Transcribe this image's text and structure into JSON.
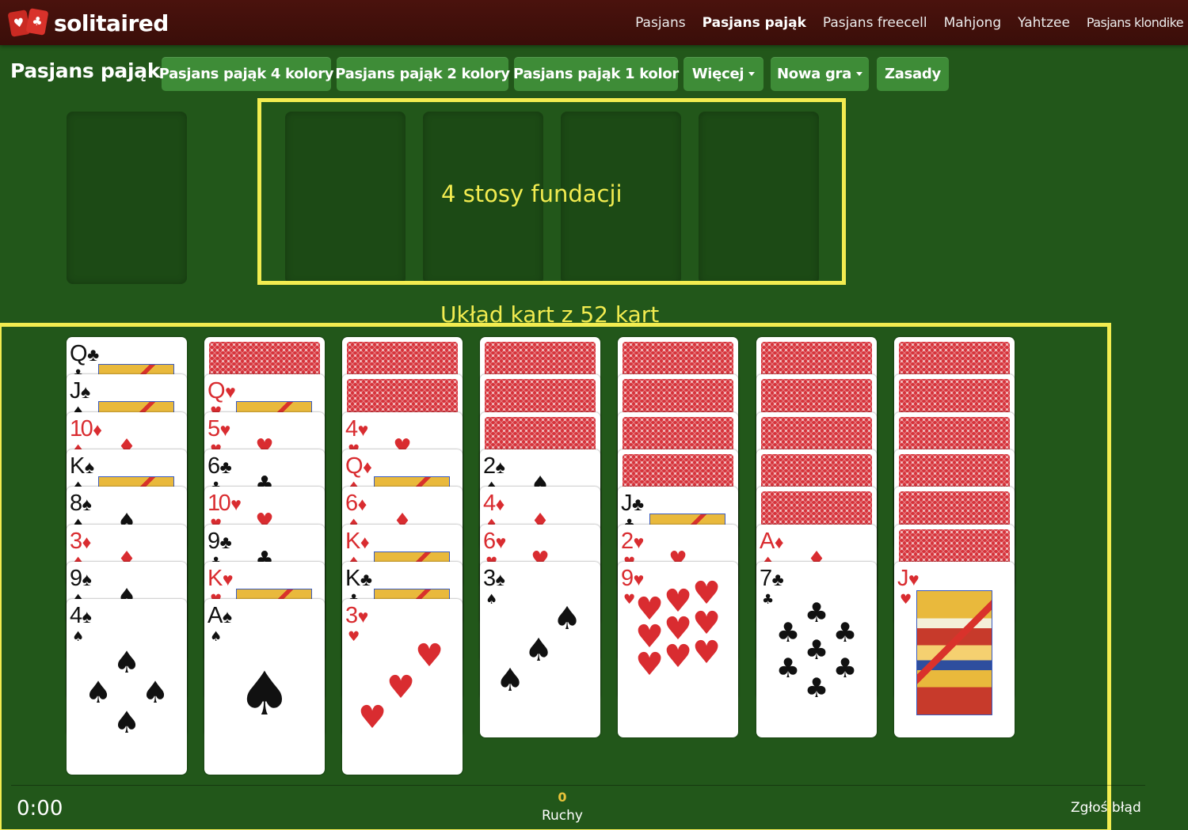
{
  "nav": {
    "logo_text": "solitaired",
    "links": [
      "Pasjans",
      "Pasjans pająk",
      "Pasjans freecell",
      "Mahjong",
      "Yahtzee",
      "Pasjans klondike"
    ],
    "active": "Pasjans pająk"
  },
  "toolbar": {
    "title": "Pasjans pająk",
    "buttons": [
      "Pasjans pająk 4 kolory",
      "Pasjans pająk 2 kolory",
      "Pasjans pająk 1 kolor",
      "Więcej",
      "Nowa gra",
      "Zasady"
    ]
  },
  "annotations": {
    "foundations": "4 stosy fundacji",
    "tableau": "Układ kart z 52 kart"
  },
  "colors": {
    "felt": "#22571a",
    "button": "#3e8c37",
    "highlight": "#f2ec50",
    "red_suit": "#d92c30",
    "card_back": "#d6323a"
  },
  "tableau": [
    {
      "facedown": 0,
      "cards": [
        [
          "Q",
          "♣"
        ],
        [
          "J",
          "♠"
        ],
        [
          "10",
          "♦"
        ],
        [
          "K",
          "♠"
        ],
        [
          "8",
          "♠"
        ],
        [
          "3",
          "♦"
        ],
        [
          "9",
          "♠"
        ],
        [
          "4",
          "♠"
        ]
      ]
    },
    {
      "facedown": 1,
      "cards": [
        [
          "Q",
          "♥"
        ],
        [
          "5",
          "♥"
        ],
        [
          "6",
          "♣"
        ],
        [
          "10",
          "♥"
        ],
        [
          "9",
          "♣"
        ],
        [
          "K",
          "♥"
        ],
        [
          "A",
          "♠"
        ]
      ]
    },
    {
      "facedown": 2,
      "cards": [
        [
          "4",
          "♥"
        ],
        [
          "Q",
          "♦"
        ],
        [
          "6",
          "♦"
        ],
        [
          "K",
          "♦"
        ],
        [
          "K",
          "♣"
        ],
        [
          "3",
          "♥"
        ]
      ]
    },
    {
      "facedown": 3,
      "cards": [
        [
          "2",
          "♠"
        ],
        [
          "4",
          "♦"
        ],
        [
          "6",
          "♥"
        ],
        [
          "3",
          "♠"
        ]
      ]
    },
    {
      "facedown": 4,
      "cards": [
        [
          "J",
          "♣"
        ],
        [
          "2",
          "♥"
        ],
        [
          "9",
          "♥"
        ]
      ]
    },
    {
      "facedown": 5,
      "cards": [
        [
          "A",
          "♦"
        ],
        [
          "7",
          "♣"
        ]
      ]
    },
    {
      "facedown": 6,
      "cards": [
        [
          "J",
          "♥"
        ]
      ]
    }
  ],
  "footer": {
    "timer": "0:00",
    "moves": "0",
    "moves_label": "Ruchy",
    "report": "Zgłoś błąd"
  }
}
